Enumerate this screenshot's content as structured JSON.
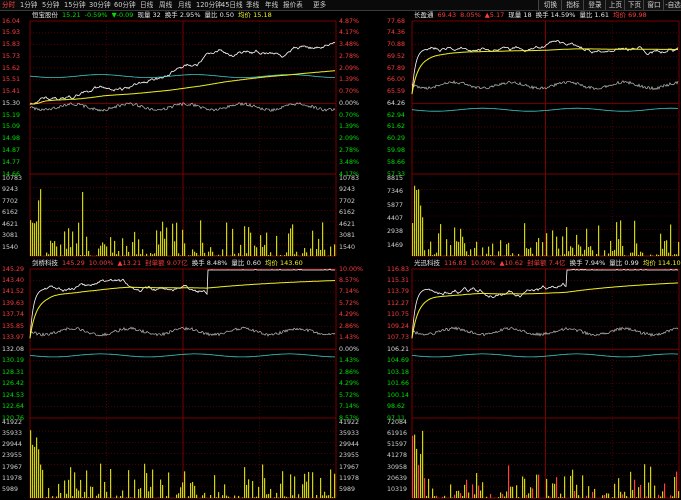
{
  "toolbar": {
    "periods": [
      "分时",
      "1分钟",
      "5分钟",
      "15分钟",
      "30分钟",
      "60分钟",
      "日线",
      "周线",
      "月线",
      "120分钟",
      "45日线",
      "季线",
      "年线",
      "报价表",
      "更多"
    ],
    "tools": [
      "切换",
      "指标",
      "登录",
      "上页",
      "下页",
      "窗口",
      "-自选"
    ]
  },
  "colors": {
    "up": "#ff3c3c",
    "down": "#00e000",
    "flat": "#dcdcdc",
    "yellow": "#f0f020",
    "cyan": "#40c8c8",
    "grid": "#7a0000"
  },
  "panels": [
    {
      "id": "p1",
      "header": [
        {
          "t": "恒宝股份",
          "c": "#e6e6e6"
        },
        {
          "t": "15.21",
          "c": "#00e000"
        },
        {
          "t": "-0.59%",
          "c": "#00e000"
        },
        {
          "t": "▼-0.09",
          "c": "#00e000"
        },
        {
          "t": "现量 32",
          "c": "#e6e6e6"
        },
        {
          "t": "换手 2.95%",
          "c": "#e6e6e6"
        },
        {
          "t": "量比 0.50",
          "c": "#e6e6e6"
        },
        {
          "t": "均价 15.18",
          "c": "#f0f020"
        }
      ],
      "price_left": [
        "16.04",
        "15.93",
        "15.83",
        "15.73",
        "15.62",
        "15.51",
        "15.41",
        "15.30",
        "15.19",
        "15.09",
        "14.98",
        "14.87",
        "14.77",
        "14.66"
      ],
      "price_right": [
        "4.87%",
        "4.17%",
        "3.48%",
        "2.78%",
        "2.09%",
        "1.39%",
        "0.70%",
        "0.00%",
        "0.70%",
        "1.39%",
        "2.09%",
        "2.78%",
        "3.48%",
        "4.17%"
      ],
      "vol_left": [
        "10783",
        "9243",
        "7702",
        "6162",
        "4621",
        "3081",
        "1540"
      ],
      "vol_right": [
        "10783",
        "9243",
        "7702",
        "6162",
        "4621",
        "3081",
        "1540"
      ]
    },
    {
      "id": "p2",
      "header": [
        {
          "t": "长盈通",
          "c": "#e6e6e6"
        },
        {
          "t": "69.43",
          "c": "#ff3c3c"
        },
        {
          "t": "8.05%",
          "c": "#ff3c3c"
        },
        {
          "t": "▲5.17",
          "c": "#ff3c3c"
        },
        {
          "t": "现量 18",
          "c": "#e6e6e6"
        },
        {
          "t": "换手 14.59%",
          "c": "#e6e6e6"
        },
        {
          "t": "量比 1.61",
          "c": "#e6e6e6"
        },
        {
          "t": "均价 69.98",
          "c": "#ff3c3c"
        }
      ],
      "price_left": [
        "77.68",
        "74.36",
        "70.88",
        "69.52",
        "67.89",
        "66.00",
        "65.59",
        "64.26",
        "62.94",
        "61.62",
        "60.29",
        "59.98",
        "58.66",
        "57.33"
      ],
      "price_right": [],
      "vol_left": [
        "8815",
        "7346",
        "5877",
        "4407",
        "2938",
        "1469"
      ],
      "vol_right": []
    },
    {
      "id": "p3",
      "header": [
        {
          "t": "剑桥科技",
          "c": "#e6e6e6"
        },
        {
          "t": "145.29",
          "c": "#ff3c3c"
        },
        {
          "t": "10.00%",
          "c": "#ff3c3c"
        },
        {
          "t": "▲13.21",
          "c": "#ff3c3c"
        },
        {
          "t": "封单额 9.07亿",
          "c": "#ff3c3c"
        },
        {
          "t": "换手 8.48%",
          "c": "#e6e6e6"
        },
        {
          "t": "量比 0.60",
          "c": "#e6e6e6"
        },
        {
          "t": "均价 143.60",
          "c": "#f0f020"
        }
      ],
      "price_left": [
        "145.29",
        "143.40",
        "141.52",
        "139.63",
        "137.74",
        "135.85",
        "133.97",
        "132.08",
        "130.19",
        "128.31",
        "126.42",
        "124.53",
        "122.64",
        "120.76"
      ],
      "price_right": [
        "10.00%",
        "8.57%",
        "7.14%",
        "5.72%",
        "4.29%",
        "2.86%",
        "1.43%",
        "0.00%",
        "1.43%",
        "2.86%",
        "4.29%",
        "5.72%",
        "7.14%",
        "8.57%"
      ],
      "vol_left": [
        "41922",
        "35933",
        "29944",
        "23955",
        "17967",
        "11978",
        "5989"
      ],
      "vol_right": [
        "41922",
        "35933",
        "29944",
        "23955",
        "17967",
        "11978",
        "5989"
      ]
    },
    {
      "id": "p4",
      "header": [
        {
          "t": "光迅科技",
          "c": "#e6e6e6"
        },
        {
          "t": "116.83",
          "c": "#ff3c3c"
        },
        {
          "t": "10.00%",
          "c": "#ff3c3c"
        },
        {
          "t": "▲10.62",
          "c": "#ff3c3c"
        },
        {
          "t": "封单额 7.4亿",
          "c": "#ff3c3c"
        },
        {
          "t": "换手 7.94%",
          "c": "#e6e6e6"
        },
        {
          "t": "量比 0.99",
          "c": "#e6e6e6"
        },
        {
          "t": "均价 114.10",
          "c": "#f0f020"
        }
      ],
      "price_left": [
        "116.83",
        "115.31",
        "113.79",
        "112.27",
        "110.75",
        "109.24",
        "107.73",
        "106.21",
        "104.69",
        "103.18",
        "101.66",
        "100.14",
        "98.62",
        "97.11"
      ],
      "price_right": [],
      "vol_left": [
        "72084",
        "61916",
        "51597",
        "41278",
        "30958",
        "20639",
        "10319"
      ],
      "vol_right": []
    }
  ]
}
